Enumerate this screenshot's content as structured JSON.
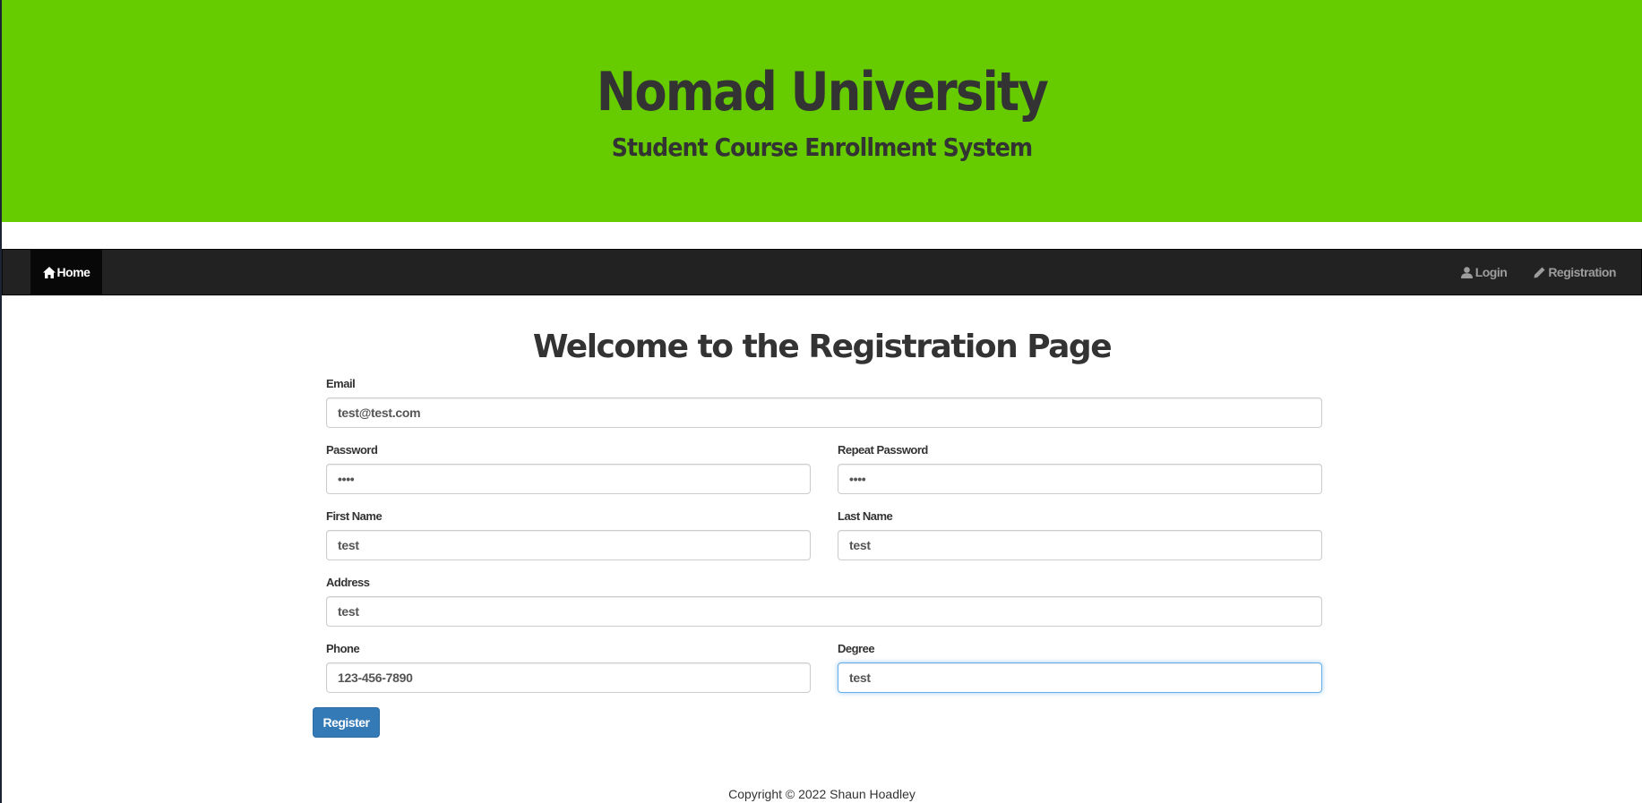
{
  "header": {
    "title": "Nomad University",
    "subtitle": "Student Course Enrollment System"
  },
  "navbar": {
    "home_label": "Home",
    "login_label": "Login",
    "registration_label": "Registration"
  },
  "main": {
    "heading": "Welcome to the Registration Page"
  },
  "form": {
    "email": {
      "label": "Email",
      "value": "test@test.com"
    },
    "password": {
      "label": "Password",
      "value": "••••"
    },
    "repeat_password": {
      "label": "Repeat Password",
      "value": "••••"
    },
    "first_name": {
      "label": "First Name",
      "value": "test"
    },
    "last_name": {
      "label": "Last Name",
      "value": "test"
    },
    "address": {
      "label": "Address",
      "value": "test"
    },
    "phone": {
      "label": "Phone",
      "value": "123-456-7890"
    },
    "degree": {
      "label": "Degree",
      "value": "test"
    },
    "submit_label": "Register"
  },
  "footer": {
    "copyright": "Copyright © 2022 Shaun Hoadley"
  },
  "colors": {
    "header_bg": "#66cc00",
    "navbar_bg": "#222222",
    "primary_button": "#337ab7",
    "focus_border": "#66afe9"
  },
  "icons": {
    "home": "home-icon",
    "login": "user-icon",
    "registration": "pencil-icon"
  }
}
